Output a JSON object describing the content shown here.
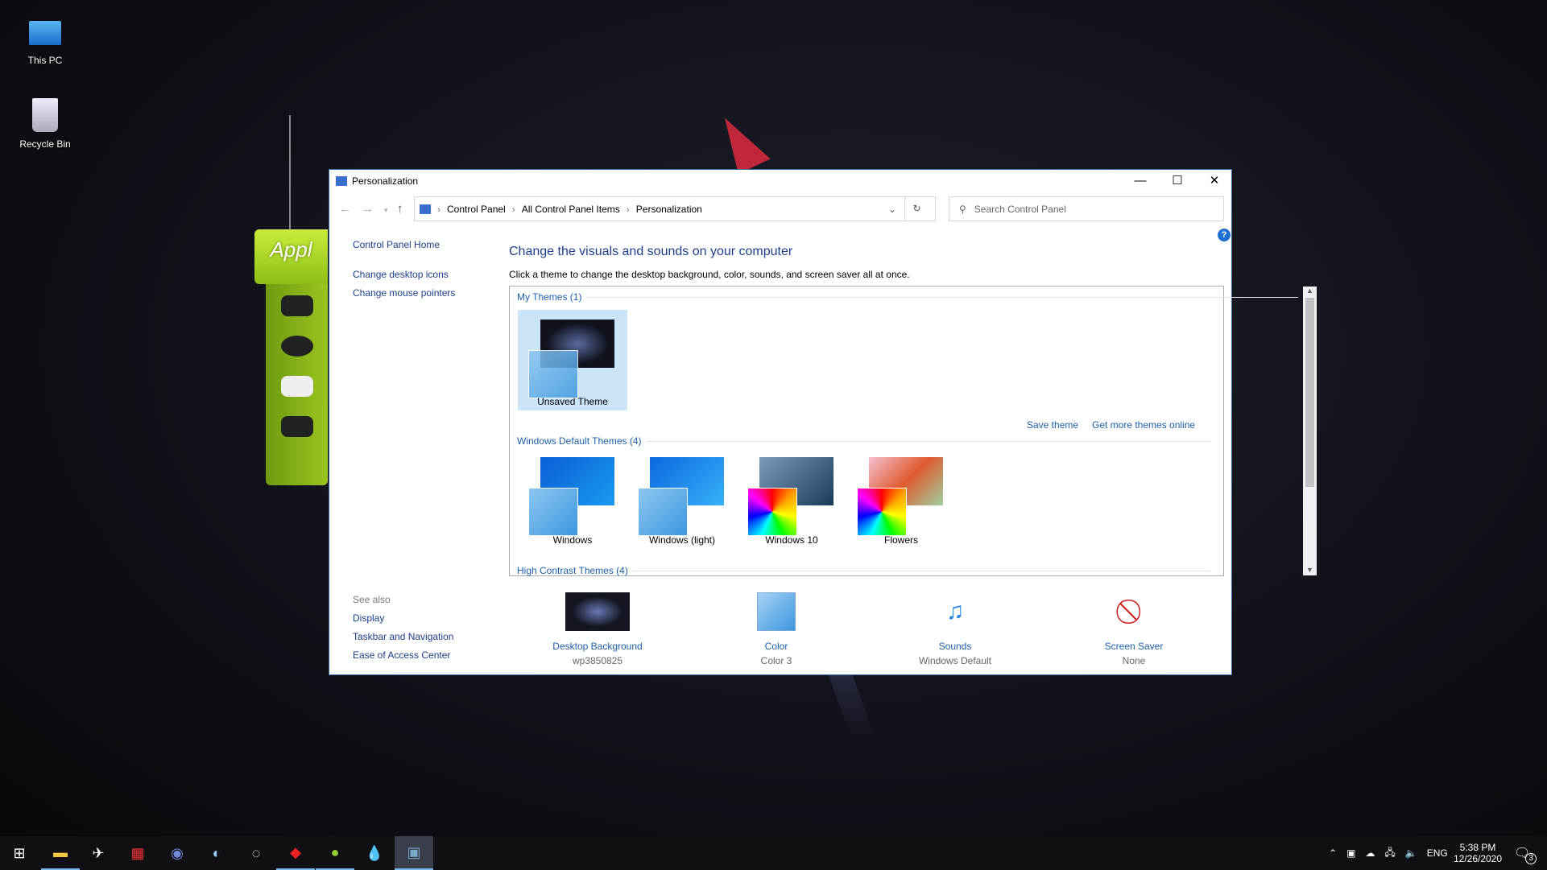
{
  "desktop": {
    "icons": [
      {
        "label": "This PC"
      },
      {
        "label": "Recycle Bin"
      }
    ],
    "widget_title": "Appl"
  },
  "window": {
    "title": "Personalization",
    "minimize": "—",
    "maximize": "☐",
    "close": "✕",
    "breadcrumb": [
      "Control Panel",
      "All Control Panel Items",
      "Personalization"
    ],
    "search_placeholder": "Search Control Panel",
    "help": "?"
  },
  "sidebar": {
    "links": [
      "Control Panel Home",
      "Change desktop icons",
      "Change mouse pointers"
    ],
    "see_also_title": "See also",
    "see_also": [
      "Display",
      "Taskbar and Navigation",
      "Ease of Access Center"
    ]
  },
  "main": {
    "heading": "Change the visuals and sounds on your computer",
    "description": "Click a theme to change the desktop background, color, sounds, and screen saver all at once.",
    "my_themes_label": "My Themes (1)",
    "my_themes": [
      {
        "name": "Unsaved Theme",
        "selected": true
      }
    ],
    "save_theme": "Save theme",
    "get_more": "Get more themes online",
    "default_label": "Windows Default Themes (4)",
    "default_themes": [
      {
        "name": "Windows"
      },
      {
        "name": "Windows (light)"
      },
      {
        "name": "Windows 10"
      },
      {
        "name": "Flowers"
      }
    ],
    "high_contrast_label": "High Contrast Themes (4)"
  },
  "bottom": [
    {
      "label": "Desktop Background",
      "sub": "wp3850825"
    },
    {
      "label": "Color",
      "sub": "Color 3"
    },
    {
      "label": "Sounds",
      "sub": "Windows Default"
    },
    {
      "label": "Screen Saver",
      "sub": "None"
    }
  ],
  "taskbar": {
    "apps": [
      "start",
      "file-explorer",
      "app",
      "app",
      "discord",
      "steam",
      "app",
      "app",
      "app",
      "app",
      "personalization"
    ],
    "lang": "ENG",
    "time": "5:38 PM",
    "date": "12/26/2020",
    "notifications": "3"
  }
}
